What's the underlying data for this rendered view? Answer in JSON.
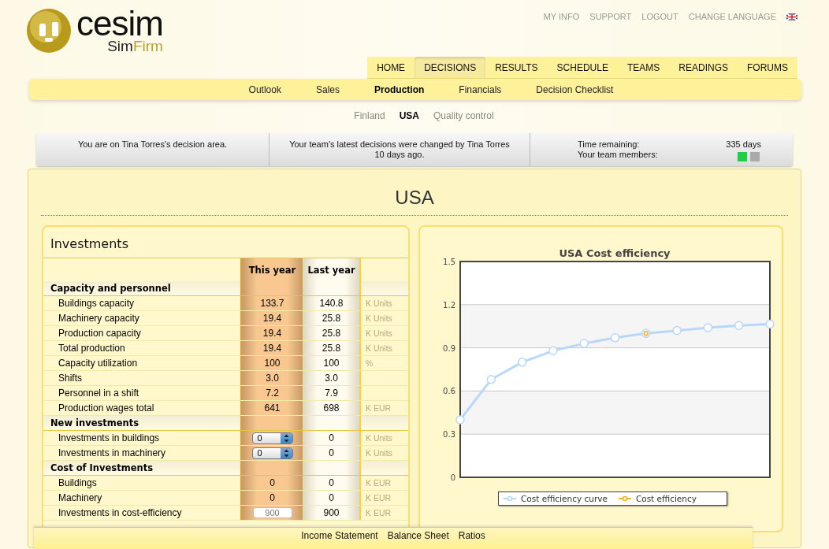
{
  "logo": {
    "word": "cesim",
    "sub_dark": "Sim",
    "sub_light": "Firm"
  },
  "top_links": [
    "MY INFO",
    "SUPPORT",
    "LOGOUT",
    "CHANGE LANGUAGE"
  ],
  "nav_tabs": [
    {
      "label": "HOME",
      "selected": false
    },
    {
      "label": "DECISIONS",
      "selected": true
    },
    {
      "label": "RESULTS",
      "selected": false
    },
    {
      "label": "SCHEDULE",
      "selected": false
    },
    {
      "label": "TEAMS",
      "selected": false
    },
    {
      "label": "READINGS",
      "selected": false
    },
    {
      "label": "FORUMS",
      "selected": false
    }
  ],
  "sub_tabs": [
    {
      "label": "Outlook",
      "selected": false
    },
    {
      "label": "Sales",
      "selected": false
    },
    {
      "label": "Production",
      "selected": true
    },
    {
      "label": "Financials",
      "selected": false
    },
    {
      "label": "Decision Checklist",
      "selected": false
    }
  ],
  "area_tabs": [
    {
      "label": "Finland",
      "selected": false
    },
    {
      "label": "USA",
      "selected": true
    },
    {
      "label": "Quality control",
      "selected": false
    }
  ],
  "info_bar": {
    "area": "You are on Tina Torres's decision area.",
    "changed": "Your team's latest decisions were changed by Tina Torres 10 days ago.",
    "time_label": "Time remaining:",
    "time_value": "335 days",
    "members_label": "Your team members:",
    "members": [
      {
        "color": "#22cc44"
      },
      {
        "color": "#aaaaaa"
      }
    ]
  },
  "page_title": "USA",
  "investments": {
    "title": "Investments",
    "columns": [
      "This year",
      "Last year"
    ],
    "rows": [
      {
        "kind": "section",
        "label": "Capacity and personnel"
      },
      {
        "kind": "row",
        "label": "Buildings capacity",
        "this_year": "133.7",
        "last_year": "140.8",
        "unit": "K Units"
      },
      {
        "kind": "row",
        "label": "Machinery capacity",
        "this_year": "19.4",
        "last_year": "25.8",
        "unit": "K Units"
      },
      {
        "kind": "row",
        "label": "Production capacity",
        "this_year": "19.4",
        "last_year": "25.8",
        "unit": "K Units"
      },
      {
        "kind": "row",
        "label": "Total production",
        "this_year": "19.4",
        "last_year": "25.8",
        "unit": "K Units"
      },
      {
        "kind": "row",
        "label": "Capacity utilization",
        "this_year": "100",
        "last_year": "100",
        "unit": "%"
      },
      {
        "kind": "row",
        "label": "Shifts",
        "this_year": "3.0",
        "last_year": "3.0"
      },
      {
        "kind": "row",
        "label": "Personnel in a shift",
        "this_year": "7.2",
        "last_year": "7.9"
      },
      {
        "kind": "row",
        "label": "Production wages total",
        "this_year": "641",
        "last_year": "698",
        "unit": "K EUR"
      },
      {
        "kind": "section",
        "label": "New investments"
      },
      {
        "kind": "spinner",
        "label": "Investments in buildings",
        "this_year": "0",
        "last_year": "0",
        "unit": "K Units"
      },
      {
        "kind": "spinner",
        "label": "Investments in machinery",
        "this_year": "0",
        "last_year": "0",
        "unit": "K Units"
      },
      {
        "kind": "section",
        "label": "Cost of Investments"
      },
      {
        "kind": "row",
        "label": "Buildings",
        "this_year": "0",
        "last_year": "0",
        "unit": "K EUR"
      },
      {
        "kind": "row",
        "label": "Machinery",
        "this_year": "0",
        "last_year": "0",
        "unit": "K EUR"
      },
      {
        "kind": "input",
        "label": "Investments in cost-efficiency",
        "this_year": "900",
        "last_year": "900",
        "unit": "K EUR"
      }
    ]
  },
  "chart": {
    "chart_data": {
      "type": "line",
      "title": "USA Cost efficiency",
      "grid": true,
      "ylim": [
        0,
        1.5
      ],
      "yticks": [
        0,
        0.3,
        0.6,
        0.9,
        1.2,
        1.5
      ],
      "series": [
        {
          "name": "Cost efficiency curve",
          "color": "#b8d8f8",
          "marker": "circle",
          "values": [
            0.4,
            0.68,
            0.8,
            0.88,
            0.93,
            0.97,
            1.0,
            1.02,
            1.04,
            1.055,
            1.065
          ]
        },
        {
          "name": "Cost efficiency",
          "color": "#f0b020",
          "marker": "circle",
          "values": [
            null,
            null,
            null,
            null,
            null,
            null,
            1.0,
            null,
            null,
            null,
            null
          ]
        }
      ]
    }
  },
  "footer_links": [
    "Income Statement",
    "Balance Sheet",
    "Ratios"
  ]
}
